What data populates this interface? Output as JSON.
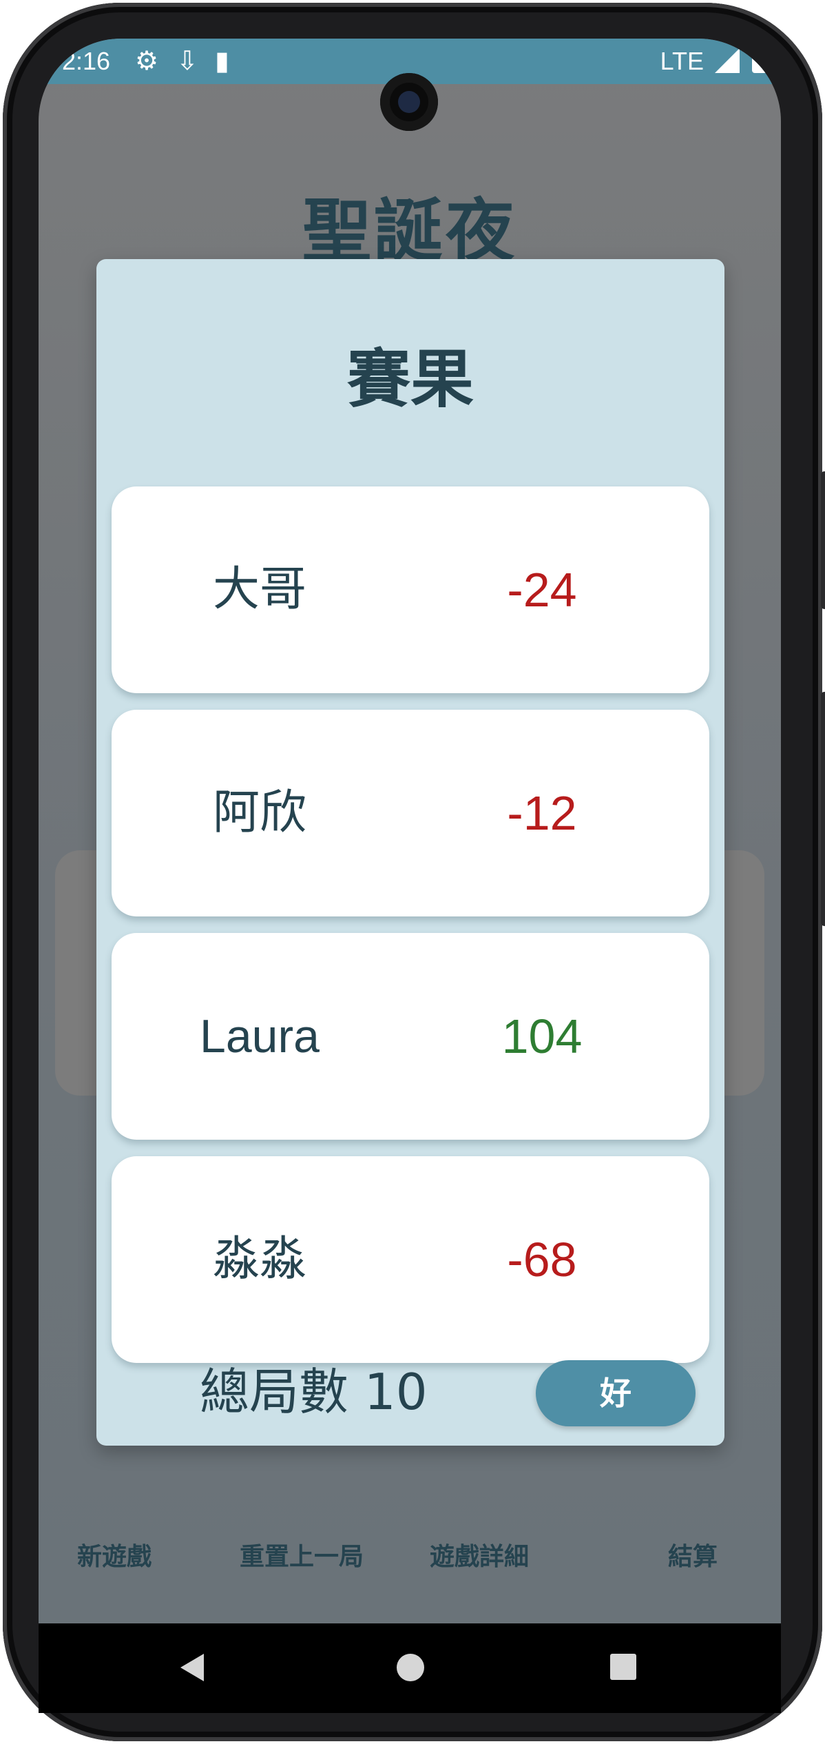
{
  "status_bar": {
    "time": "2:16",
    "network": "LTE",
    "icons": [
      "settings-icon",
      "download-icon",
      "sd-card-icon",
      "signal-icon",
      "battery-icon"
    ]
  },
  "app": {
    "title": "聖誕夜"
  },
  "dialog": {
    "title": "賽果",
    "results": [
      {
        "name": "大哥",
        "score": "-24",
        "status": "negative"
      },
      {
        "name": "阿欣",
        "score": "-12",
        "status": "negative"
      },
      {
        "name": "Laura",
        "score": "104",
        "status": "positive"
      },
      {
        "name": "淼淼",
        "score": "-68",
        "status": "negative"
      }
    ],
    "total_rounds_label": "總局數 10",
    "ok_label": "好"
  },
  "bottom_bar": {
    "new_game": "新遊戲",
    "reset_last": "重置上一局",
    "game_details": "遊戲詳細",
    "settle": "結算"
  },
  "navigation": {
    "icons": [
      "back-icon",
      "home-icon",
      "recents-icon"
    ]
  },
  "colors": {
    "accent": "#4f8fa6",
    "negative": "#b71c1c",
    "positive": "#2e7d32",
    "text": "#25434f",
    "dialog_bg": "#cce1e8"
  }
}
